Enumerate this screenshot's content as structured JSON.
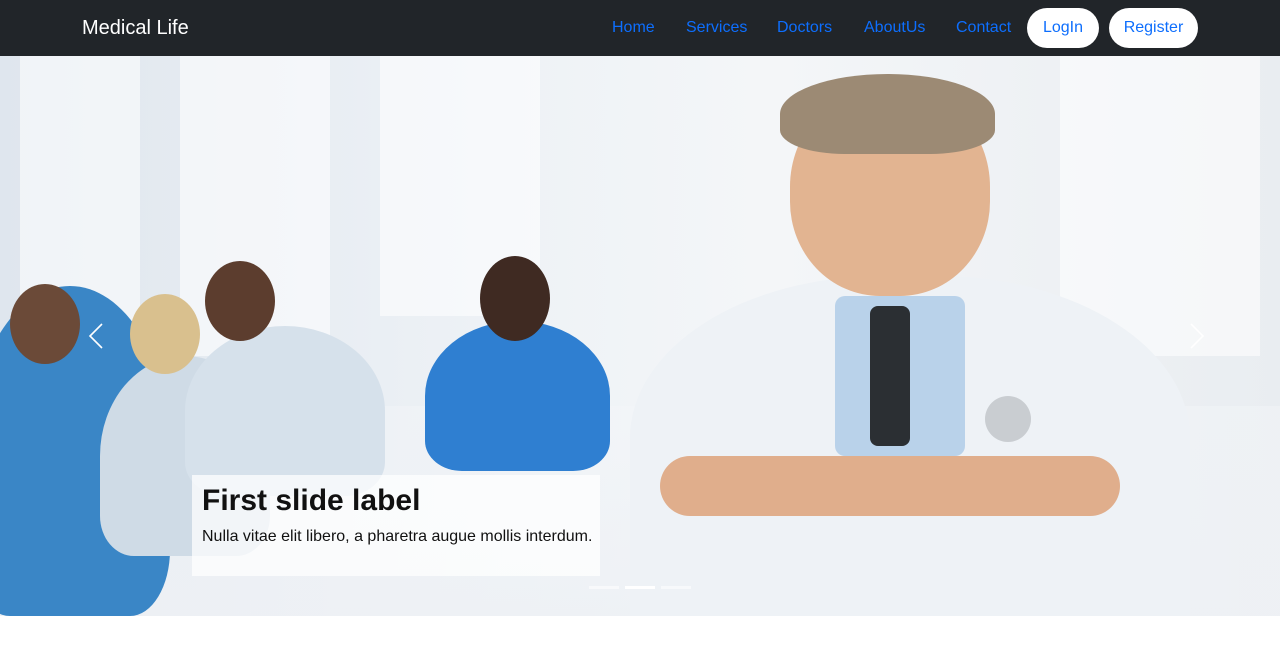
{
  "navbar": {
    "brand": "Medical Life",
    "links": [
      "Home",
      "Services",
      "Doctors",
      "AboutUs",
      "Contact"
    ],
    "login_label": "LogIn",
    "register_label": "Register",
    "background": "#212529",
    "link_color": "#0d6efd"
  },
  "carousel": {
    "slide": {
      "title": "First slide label",
      "text": "Nulla vitae elit libero, a pharetra augue mollis interdum."
    },
    "prev_icon": "chevron-left-icon",
    "next_icon": "chevron-right-icon",
    "indicator_count": 3,
    "active_indicator": 2
  }
}
